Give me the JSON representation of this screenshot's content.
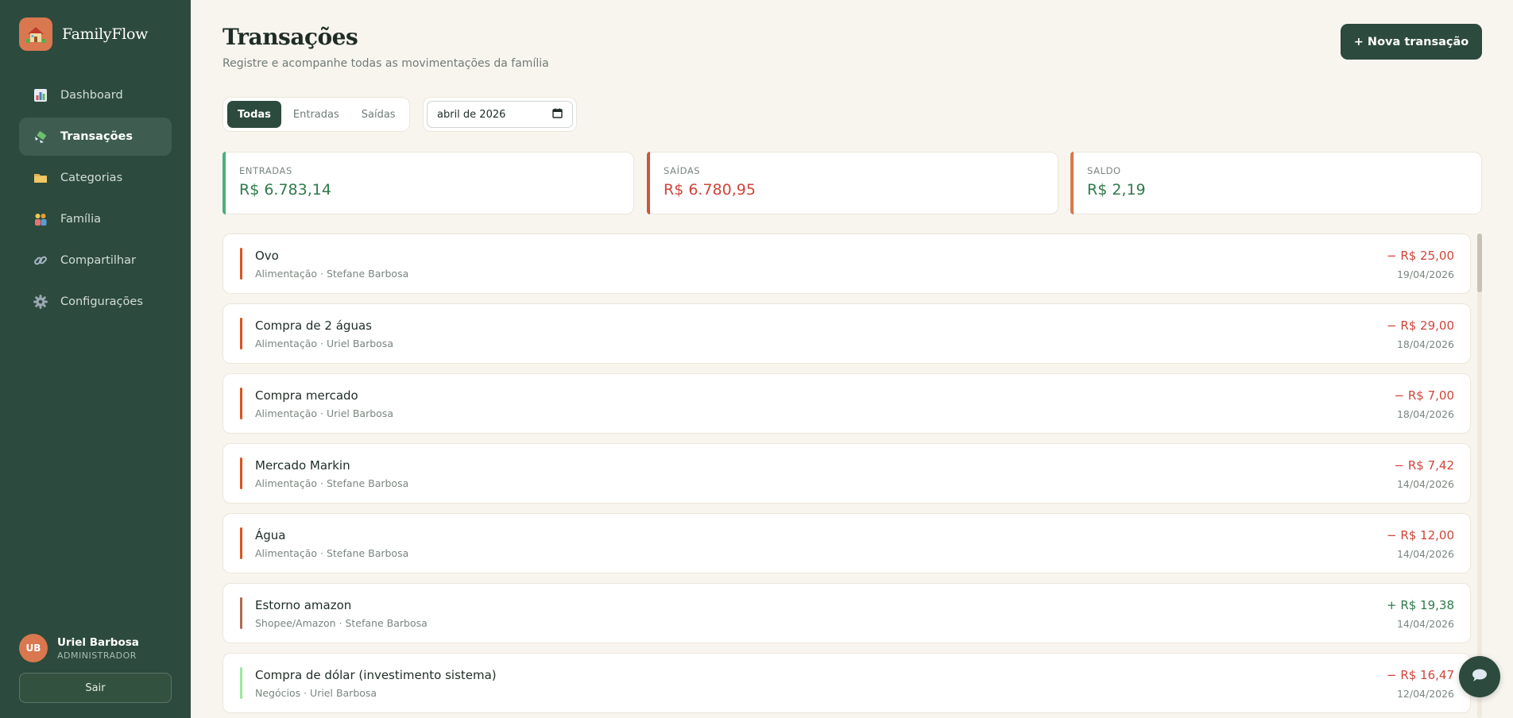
{
  "brand": {
    "name": "FamilyFlow",
    "logo_icon": "house-icon",
    "accent": "#d9774e"
  },
  "nav": [
    {
      "label": "Dashboard",
      "icon": "chart-icon"
    },
    {
      "label": "Transações",
      "icon": "money-wings-icon",
      "active": true
    },
    {
      "label": "Categorias",
      "icon": "folder-icon"
    },
    {
      "label": "Família",
      "icon": "family-icon"
    },
    {
      "label": "Compartilhar",
      "icon": "link-icon"
    },
    {
      "label": "Configurações",
      "icon": "gear-icon"
    }
  ],
  "user": {
    "initials": "UB",
    "name": "Uriel Barbosa",
    "role": "ADMINISTRADOR",
    "logout_label": "Sair"
  },
  "header": {
    "title": "Transações",
    "subtitle": "Registre e acompanhe todas as movimentações da família",
    "new_button": "+ Nova transação"
  },
  "filters": {
    "options": [
      "Todas",
      "Entradas",
      "Saídas"
    ],
    "selected": "Todas",
    "month": "abril de 2026"
  },
  "summary": {
    "income": {
      "label": "ENTRADAS",
      "value": "R$ 6.783,14"
    },
    "expense": {
      "label": "SAÍDAS",
      "value": "R$ 6.780,95"
    },
    "balance": {
      "label": "SALDO",
      "value": "R$ 2,19"
    }
  },
  "transactions": [
    {
      "title": "Ovo",
      "meta": "Alimentação · Stefane Barbosa",
      "amount": "− R$ 25,00",
      "date": "19/04/2026",
      "type": "out",
      "color": "#d9541e"
    },
    {
      "title": "Compra de 2 águas",
      "meta": "Alimentação · Uriel Barbosa",
      "amount": "− R$ 29,00",
      "date": "18/04/2026",
      "type": "out",
      "color": "#d9541e"
    },
    {
      "title": "Compra mercado",
      "meta": "Alimentação · Uriel Barbosa",
      "amount": "− R$ 7,00",
      "date": "18/04/2026",
      "type": "out",
      "color": "#d9541e"
    },
    {
      "title": "Mercado Markin",
      "meta": "Alimentação · Stefane Barbosa",
      "amount": "− R$ 7,42",
      "date": "14/04/2026",
      "type": "out",
      "color": "#d9541e"
    },
    {
      "title": "Água",
      "meta": "Alimentação · Stefane Barbosa",
      "amount": "− R$ 12,00",
      "date": "14/04/2026",
      "type": "out",
      "color": "#d9541e"
    },
    {
      "title": "Estorno amazon",
      "meta": "Shopee/Amazon · Stefane Barbosa",
      "amount": "+ R$ 19,38",
      "date": "14/04/2026",
      "type": "in",
      "color": "#b06a55"
    },
    {
      "title": "Compra de dólar (investimento sistema)",
      "meta": "Negócios · Uriel Barbosa",
      "amount": "− R$ 16,47",
      "date": "12/04/2026",
      "type": "out",
      "color": "#9ee6a0"
    }
  ],
  "chat_button_icon": "chat-bubble-icon"
}
